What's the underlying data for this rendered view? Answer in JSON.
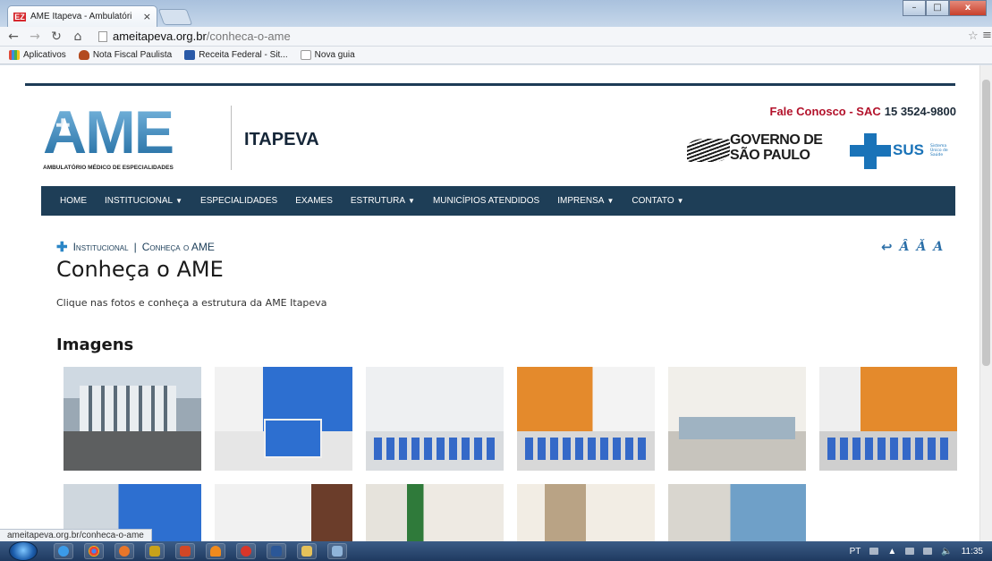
{
  "browser": {
    "tab_title": "AME Itapeva - Ambulatóri",
    "tab_favicon": "EZ",
    "tab_close": "×",
    "url_domain": "ameitapeva.org.br",
    "url_path": "/conheca-o-ame",
    "status_url": "ameitapeva.org.br/conheca-o-ame",
    "bookmarks": [
      {
        "label": "Aplicativos",
        "icon": "apps-grid-icon",
        "color": "#e04b3a"
      },
      {
        "label": "Nota Fiscal Paulista",
        "icon": "nfp-icon",
        "color": "#b34a1e"
      },
      {
        "label": "Receita Federal - Sit...",
        "icon": "receita-icon",
        "color": "#2a5aa8"
      },
      {
        "label": "Nova guia",
        "icon": "page-icon",
        "color": "#ffffff"
      }
    ]
  },
  "site": {
    "logo_text": "AME",
    "logo_subtitle": "AMBULATÓRIO MÉDICO DE ESPECIALIDADES",
    "city": "ITAPEVA",
    "sac_label": "Fale Conosco - SAC",
    "sac_phone": "15 3524-9800",
    "gov_line1": "GOVERNO DE",
    "gov_line2": "SÃO PAULO",
    "sus_label": "SUS",
    "sus_small": "Sistema Único de Saúde",
    "nav": [
      {
        "label": "HOME",
        "dropdown": false
      },
      {
        "label": "INSTITUCIONAL",
        "dropdown": true
      },
      {
        "label": "ESPECIALIDADES",
        "dropdown": false
      },
      {
        "label": "EXAMES",
        "dropdown": false
      },
      {
        "label": "ESTRUTURA",
        "dropdown": true
      },
      {
        "label": "MUNICÍPIOS ATENDIDOS",
        "dropdown": false
      },
      {
        "label": "IMPRENSA",
        "dropdown": true
      },
      {
        "label": "CONTATO",
        "dropdown": true
      }
    ],
    "colors": {
      "navy": "#1e3e57",
      "brand_blue": "#2b86c6",
      "sac_red": "#b3122b"
    }
  },
  "content": {
    "breadcrumb_section": "Institucional",
    "breadcrumb_separator": "|",
    "breadcrumb_page": "Conheça o AME",
    "title": "Conheça o AME",
    "intro": "Clique nas fotos e conheça a estrutura da AME Itapeva",
    "gallery_title": "Imagens"
  },
  "taskbar": {
    "clock": "11:35",
    "language": "PT"
  }
}
